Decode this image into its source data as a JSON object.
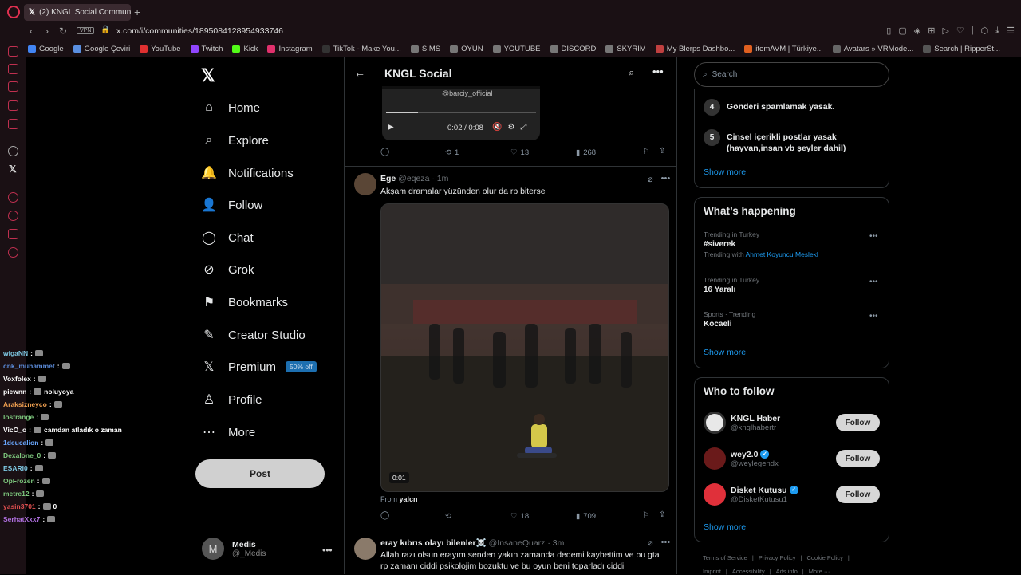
{
  "browser": {
    "tab_title": "(2) KNGL Social Communi",
    "url": "x.com/i/communities/1895084128954933746",
    "vpn": "VPN",
    "bookmarks": [
      "Google",
      "Google Çeviri",
      "YouTube",
      "Twitch",
      "Kick",
      "Instagram",
      "TikTok - Make You...",
      "SIMS",
      "OYUN",
      "YOUTUBE",
      "DISCORD",
      "SKYRIM",
      "My Blerps Dashbo...",
      "itemAVM | Türkiye...",
      "Avatars » VRMode...",
      "Search | RipperSt..."
    ]
  },
  "chat": [
    {
      "user": "wigaNN",
      "color": "#7ec8e3",
      "msg": ""
    },
    {
      "user": "cnk_muhammet",
      "color": "#5b8bd9",
      "msg": ""
    },
    {
      "user": "Voxfolex",
      "color": "#ffffff",
      "msg": ""
    },
    {
      "user": "piewnn",
      "color": "#ffffff",
      "msg": "noluyoya"
    },
    {
      "user": "Araksizneyco",
      "color": "#f0a050",
      "msg": ""
    },
    {
      "user": "lostrange",
      "color": "#7ec87e",
      "msg": ""
    },
    {
      "user": "VicO_o",
      "color": "#ffffff",
      "msg": "camdan atladık o zaman"
    },
    {
      "user": "1deucalion",
      "color": "#6aa8ff",
      "msg": ""
    },
    {
      "user": "Dexalone_0",
      "color": "#7ec87e",
      "msg": ""
    },
    {
      "user": "ESARI0",
      "color": "#7ec8e3",
      "msg": ""
    },
    {
      "user": "OpFrozen",
      "color": "#7ec87e",
      "msg": ""
    },
    {
      "user": "metre12",
      "color": "#7ec87e",
      "msg": ""
    },
    {
      "user": "yasin3701",
      "color": "#e05050",
      "msg": "0"
    },
    {
      "user": "SerhatXxx7",
      "color": "#b070e0",
      "msg": ""
    }
  ],
  "nav": {
    "items": [
      "Home",
      "Explore",
      "Notifications",
      "Follow",
      "Chat",
      "Grok",
      "Bookmarks",
      "Creator Studio",
      "Premium",
      "Profile",
      "More"
    ],
    "premium_badge": "50% off",
    "post_label": "Post",
    "account_name": "Medis",
    "account_handle": "@_Medis",
    "avatar_letter": "M"
  },
  "feed": {
    "title": "KNGL Social",
    "video1": {
      "handle": "@barciy_official",
      "time": "0:02 / 0:08"
    },
    "post1_actions": {
      "replies": "",
      "reposts": "1",
      "likes": "13",
      "views": "268"
    },
    "post2": {
      "name": "Ege",
      "handle": "@eqeza · 1m",
      "text": "Akşam dramalar yüzünden olur da rp biterse",
      "video_time": "0:01",
      "from_label": "From",
      "from_user": "yalcn",
      "actions": {
        "replies": "",
        "reposts": "",
        "likes": "18",
        "views": "709"
      }
    },
    "post3": {
      "name": "eray kıbrıs olayı bilenler☠️",
      "handle": "@InsaneQuarz · 3m",
      "text": "Allah razı olsun erayım senden yakın zamanda dedemi kaybettim ve bu gta rp zamanı ciddi psikolojim bozuktu ve bu oyun beni toparladı ciddi"
    }
  },
  "right": {
    "search_placeholder": "Search",
    "rules": [
      {
        "num": "4",
        "text": "Gönderi spamlamak yasak."
      },
      {
        "num": "5",
        "text": "Cinsel içerikli postlar yasak (hayvan,insan vb şeyler dahil)"
      }
    ],
    "show_more": "Show more",
    "happening_title": "What’s happening",
    "trends": [
      {
        "ctx": "Trending in Turkey",
        "name": "#siverek",
        "with_label": "Trending with",
        "with": "Ahmet Koyuncu Meslekl"
      },
      {
        "ctx": "Trending in Turkey",
        "name": "16 Yaralı"
      },
      {
        "ctx": "Sports · Trending",
        "name": "Kocaeli"
      }
    ],
    "who_title": "Who to follow",
    "who": [
      {
        "name": "KNGL Haber",
        "handle": "@knglhabertr",
        "verified": false
      },
      {
        "name": "wey2.0",
        "handle": "@weylegendx",
        "verified": true
      },
      {
        "name": "Disket Kutusu",
        "handle": "@DisketKutusu1",
        "verified": true
      }
    ],
    "follow_label": "Follow",
    "footer": [
      "Terms of Service",
      "Privacy Policy",
      "Cookie Policy",
      "Imprint",
      "Accessibility",
      "Ads info",
      "More ···"
    ]
  }
}
